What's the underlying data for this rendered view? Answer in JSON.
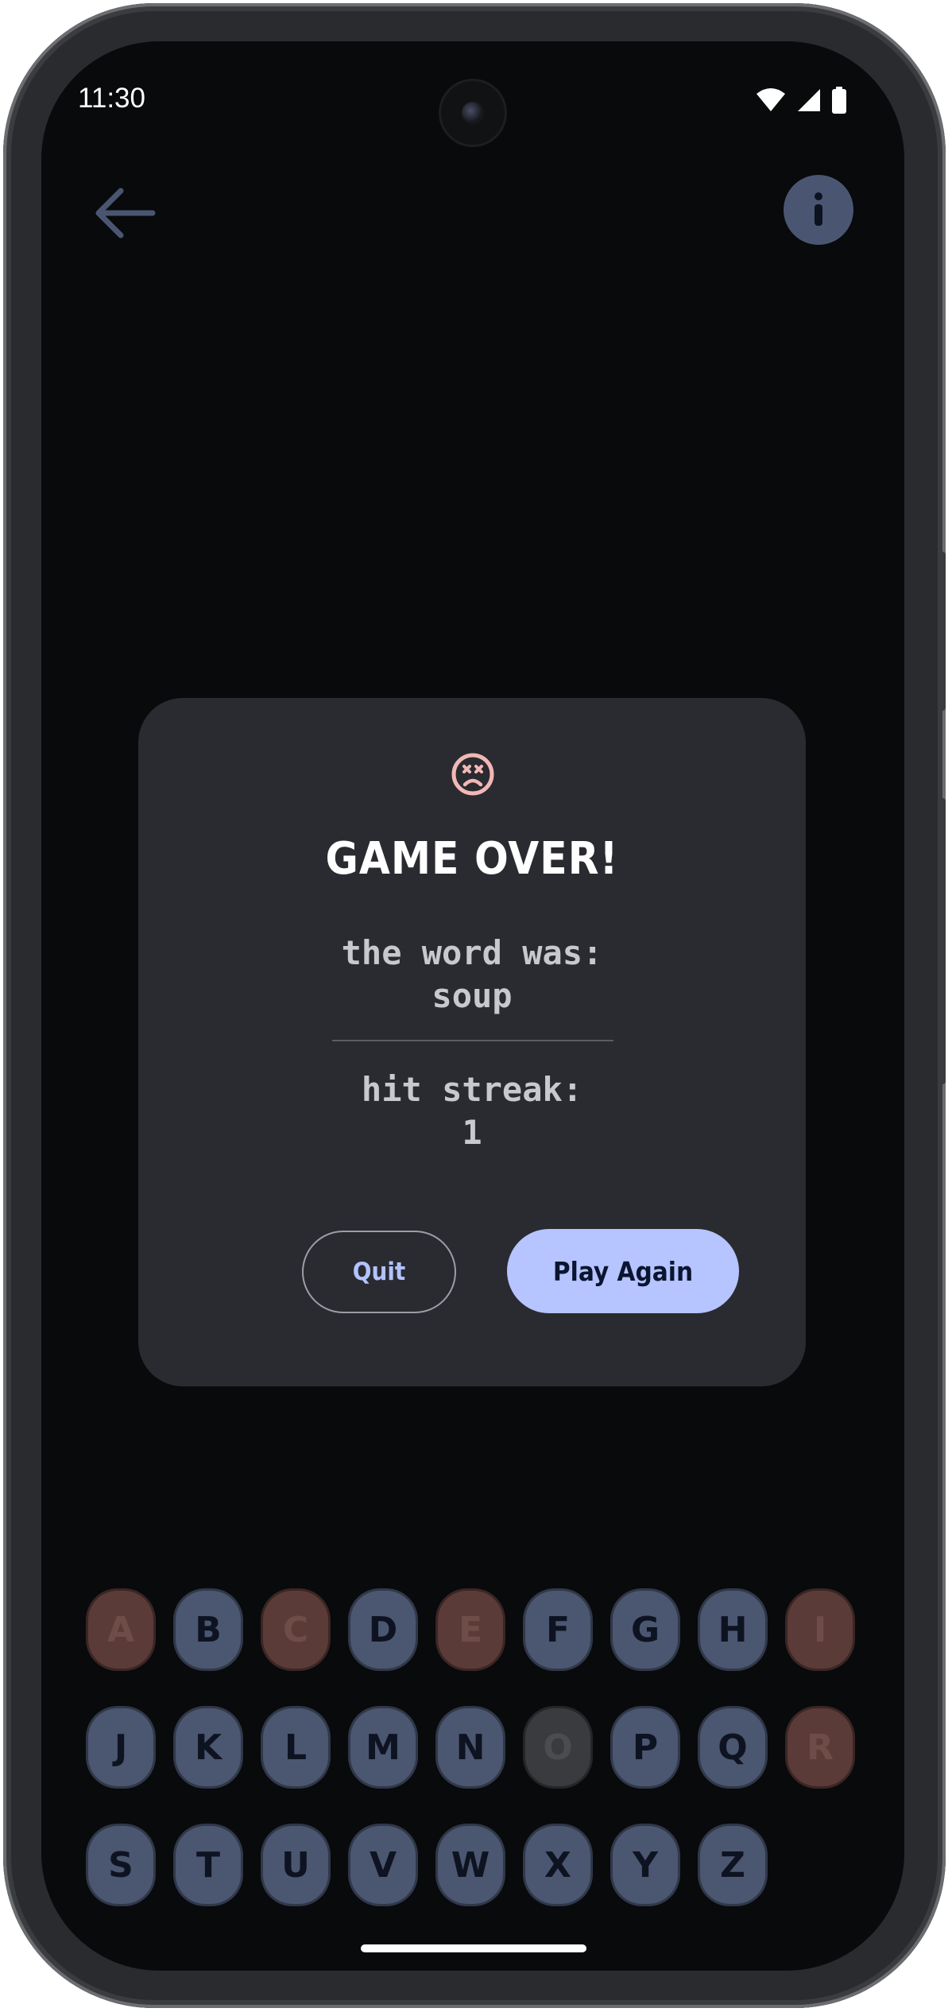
{
  "status_bar": {
    "time": "11:30"
  },
  "colors": {
    "accent": "#b6c4ff",
    "key_default": "#4b5670",
    "key_wrong": "#5b3b38",
    "key_unused": "#3a3b3e",
    "dialog_bg": "#2a2b30",
    "sad_icon": "#f2b8b5"
  },
  "icons": {
    "back": "arrow-left-icon",
    "info": "info-icon",
    "dialog": "sad-face-icon"
  },
  "dialog": {
    "title": "GAME OVER!",
    "word_label": "the word was:",
    "word": "soup",
    "streak_label": "hit streak:",
    "streak_value": "1",
    "quit_label": "Quit",
    "play_again_label": "Play Again"
  },
  "keyboard": {
    "rows": [
      [
        {
          "letter": "A",
          "state": "wrong"
        },
        {
          "letter": "B",
          "state": "default"
        },
        {
          "letter": "C",
          "state": "wrong"
        },
        {
          "letter": "D",
          "state": "default"
        },
        {
          "letter": "E",
          "state": "wrong"
        },
        {
          "letter": "F",
          "state": "default"
        },
        {
          "letter": "G",
          "state": "default"
        },
        {
          "letter": "H",
          "state": "default"
        },
        {
          "letter": "I",
          "state": "wrong"
        }
      ],
      [
        {
          "letter": "J",
          "state": "default"
        },
        {
          "letter": "K",
          "state": "default"
        },
        {
          "letter": "L",
          "state": "default"
        },
        {
          "letter": "M",
          "state": "default"
        },
        {
          "letter": "N",
          "state": "default"
        },
        {
          "letter": "O",
          "state": "used"
        },
        {
          "letter": "P",
          "state": "default"
        },
        {
          "letter": "Q",
          "state": "default"
        },
        {
          "letter": "R",
          "state": "wrong"
        }
      ],
      [
        {
          "letter": "S",
          "state": "default"
        },
        {
          "letter": "T",
          "state": "default"
        },
        {
          "letter": "U",
          "state": "default"
        },
        {
          "letter": "V",
          "state": "default"
        },
        {
          "letter": "W",
          "state": "default"
        },
        {
          "letter": "X",
          "state": "default"
        },
        {
          "letter": "Y",
          "state": "default"
        },
        {
          "letter": "Z",
          "state": "default"
        }
      ]
    ]
  }
}
